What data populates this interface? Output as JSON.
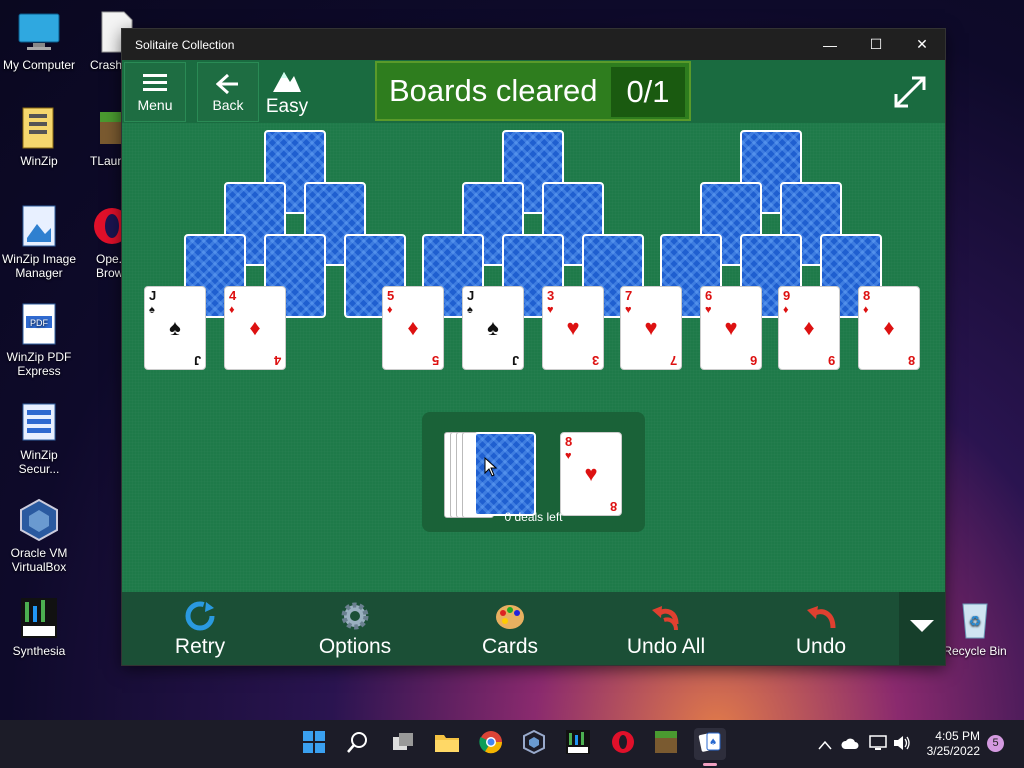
{
  "desktop": {
    "icons": [
      {
        "label": "My Computer"
      },
      {
        "label": "Crash..."
      },
      {
        "label": "WinZip"
      },
      {
        "label": "TLaun..."
      },
      {
        "label": "WinZip Image Manager"
      },
      {
        "label": "Ope... Brow..."
      },
      {
        "label": "WinZip PDF Express"
      },
      {
        "label": "WinZip Secur..."
      },
      {
        "label": "Oracle VM VirtualBox"
      },
      {
        "label": "Synthesia"
      },
      {
        "label": "Recycle Bin"
      }
    ]
  },
  "window": {
    "title": "Solitaire Collection",
    "minimize": "—",
    "maximize": "☐",
    "close": "✕"
  },
  "topbar": {
    "menu_label": "Menu",
    "back_label": "Back",
    "difficulty_label": "Easy",
    "boards_label": "Boards cleared",
    "boards_count": "0/1"
  },
  "game": {
    "row4_cards": [
      {
        "rank": "J",
        "suit": "♠",
        "color": "black"
      },
      {
        "rank": "4",
        "suit": "♦",
        "color": "red"
      },
      {
        "rank": "5",
        "suit": "♦",
        "color": "red"
      },
      {
        "rank": "J",
        "suit": "♠",
        "color": "black"
      },
      {
        "rank": "3",
        "suit": "♥",
        "color": "red"
      },
      {
        "rank": "7",
        "suit": "♥",
        "color": "red"
      },
      {
        "rank": "6",
        "suit": "♥",
        "color": "red"
      },
      {
        "rank": "9",
        "suit": "♦",
        "color": "red"
      },
      {
        "rank": "8",
        "suit": "♦",
        "color": "red"
      }
    ],
    "waste_card": {
      "rank": "8",
      "suit": "♥",
      "color": "red"
    },
    "deals_left": "0 deals left"
  },
  "bottombar": {
    "retry": "Retry",
    "options": "Options",
    "cards": "Cards",
    "undo_all": "Undo All",
    "undo": "Undo"
  },
  "taskbar": {
    "time": "4:05 PM",
    "date": "3/25/2022",
    "notification_count": "5"
  },
  "colors": {
    "felt": "#1e7a49",
    "card_back": "#1f5fd0",
    "board_banner": "#2e7d1e",
    "red_suit": "#d11111"
  }
}
